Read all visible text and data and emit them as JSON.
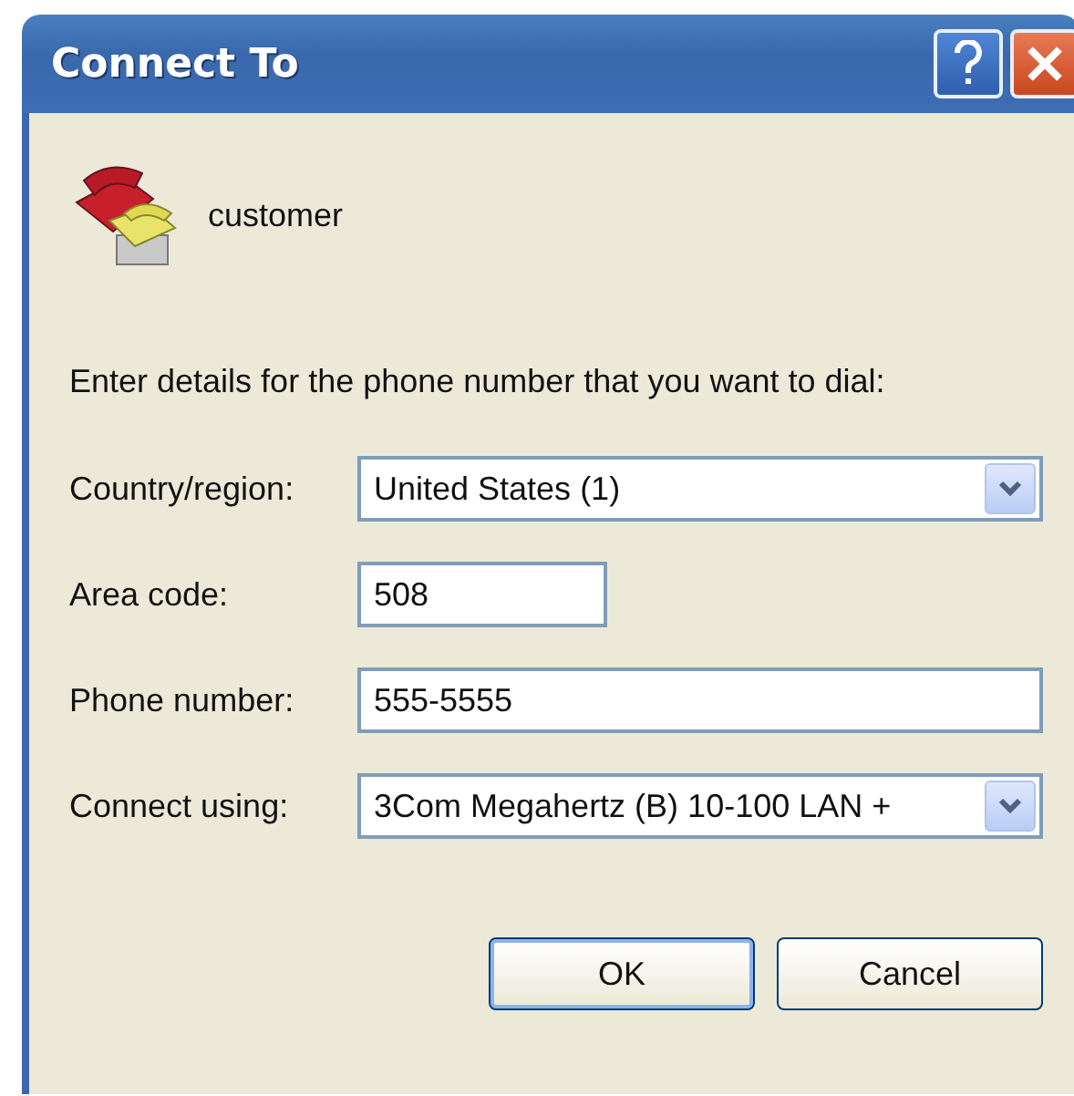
{
  "window": {
    "title": "Connect To"
  },
  "connection": {
    "name": "customer"
  },
  "instruction": "Enter details for the phone number that you want to dial:",
  "fields": [
    {
      "kind": "combo",
      "label": "Country/region:",
      "value": "United States (1)"
    },
    {
      "kind": "short",
      "label": "Area code:",
      "value": "508"
    },
    {
      "kind": "text",
      "label": "Phone number:",
      "value": "555-5555"
    },
    {
      "kind": "combo",
      "label": "Connect using:",
      "value": "3Com Megahertz (B) 10-100 LAN +"
    }
  ],
  "buttons": [
    {
      "label": "OK",
      "default": true
    },
    {
      "label": "Cancel",
      "default": false
    }
  ]
}
